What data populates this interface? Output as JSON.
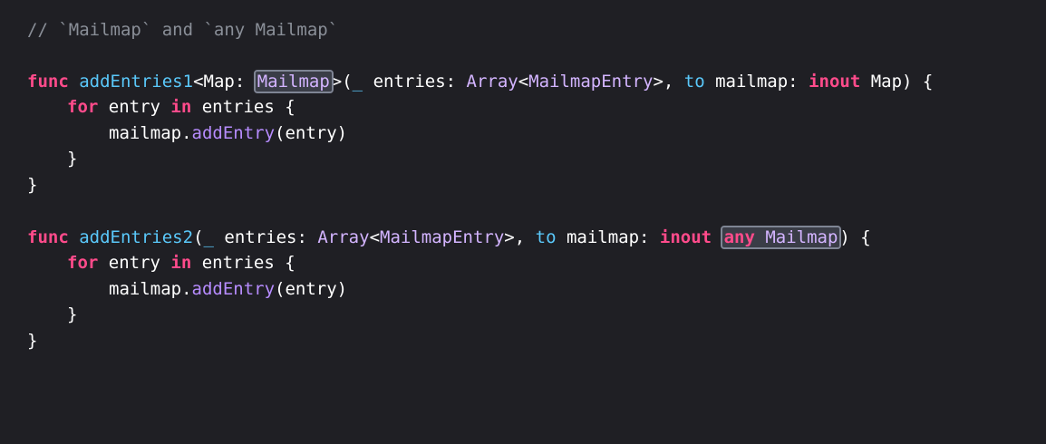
{
  "code": {
    "line1": {
      "comment": "// `Mailmap` and `any Mailmap`"
    },
    "func1": {
      "kw_func": "func",
      "name": "addEntries1",
      "generic_open": "<Map: ",
      "constraint": "Mailmap",
      "generic_close": ">(",
      "underscore": "_",
      "entries_label": " entries: ",
      "array_type": "Array",
      "lt": "<",
      "elem_type": "MailmapEntry",
      "gt_comma": ">, ",
      "to_label": "to",
      "mailmap_param": " mailmap: ",
      "kw_inout": "inout",
      "map_type": " Map) {"
    },
    "for1": {
      "kw_for": "for",
      "entry": " entry ",
      "kw_in": "in",
      "entries": " entries {"
    },
    "call1": {
      "receiver": "mailmap.",
      "method": "addEntry",
      "args": "(entry)"
    },
    "close_for1": "}",
    "close_func1": "}",
    "func2": {
      "kw_func": "func",
      "name": "addEntries2",
      "paren_open": "(",
      "underscore": "_",
      "entries_label": " entries: ",
      "array_type": "Array",
      "lt": "<",
      "elem_type": "MailmapEntry",
      "gt_comma": ">, ",
      "to_label": "to",
      "mailmap_param": " mailmap: ",
      "kw_inout": "inout",
      "space": " ",
      "kw_any": "any",
      "existential_type": " Mailmap",
      "paren_close": ") {"
    },
    "for2": {
      "kw_for": "for",
      "entry": " entry ",
      "kw_in": "in",
      "entries": " entries {"
    },
    "call2": {
      "receiver": "mailmap.",
      "method": "addEntry",
      "args": "(entry)"
    },
    "close_for2": "}",
    "close_func2": "}"
  },
  "colors": {
    "background": "#1f1f24",
    "keyword": "#ff4b8b",
    "declaration": "#5ac8fa",
    "type": "#d3b4ff",
    "method": "#b78cff",
    "comment": "#8a8f98",
    "highlight_border": "#7f8594"
  }
}
